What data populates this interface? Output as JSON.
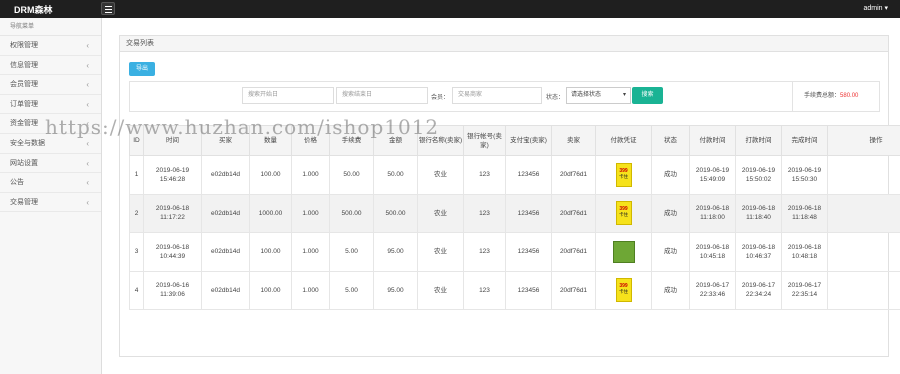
{
  "app": {
    "brand": "DRM森林",
    "user": "admin ▾"
  },
  "sidebar": {
    "heading": "导航菜单",
    "items": [
      {
        "label": "权限管理"
      },
      {
        "label": "信息管理"
      },
      {
        "label": "会员管理"
      },
      {
        "label": "订单管理"
      },
      {
        "label": "资金管理"
      },
      {
        "label": "安全与数据"
      },
      {
        "label": "网站设置"
      },
      {
        "label": "公告"
      },
      {
        "label": "交易管理"
      }
    ]
  },
  "panel": {
    "title": "交易列表",
    "export_label": "导出"
  },
  "filters": {
    "start_placeholder": "搜索开始日",
    "end_placeholder": "搜索结束日",
    "member_label": "会员：",
    "member_placeholder": "交易商家",
    "status_label": "状态：",
    "status_value": "请选择状态",
    "search_label": "搜索",
    "total_label": "手续费总额：",
    "total_value": "580.00"
  },
  "table": {
    "headers": [
      "ID",
      "时间",
      "买家",
      "数量",
      "价格",
      "手续费",
      "金额",
      "银行名称(卖家)",
      "银行帐号(卖家)",
      "支付宝(卖家)",
      "卖家",
      "付款凭证",
      "状态",
      "付款时间",
      "打款时间",
      "完成时间",
      "操作"
    ],
    "rows": [
      {
        "id": "1",
        "time": "2019-06-19 15:46:28",
        "buyer": "e02db14d",
        "qty": "100.00",
        "price": "1.000",
        "fee": "50.00",
        "amount": "50.00",
        "bank": "农业",
        "account": "123",
        "alipay": "123456",
        "seller": "20df76d1",
        "proof": "yellow",
        "status": "成功",
        "paid": "2019-06-19 15:49:09",
        "transfer": "2019-06-19 15:50:02",
        "done": "2019-06-19 15:50:30",
        "op": ""
      },
      {
        "id": "2",
        "time": "2019-06-18 11:17:22",
        "buyer": "e02db14d",
        "qty": "1000.00",
        "price": "1.000",
        "fee": "500.00",
        "amount": "500.00",
        "bank": "农业",
        "account": "123",
        "alipay": "123456",
        "seller": "20df76d1",
        "proof": "yellow",
        "status": "成功",
        "paid": "2019-06-18 11:18:00",
        "transfer": "2019-06-18 11:18:40",
        "done": "2019-06-18 11:18:48",
        "op": ""
      },
      {
        "id": "3",
        "time": "2019-06-18 10:44:39",
        "buyer": "e02db14d",
        "qty": "100.00",
        "price": "1.000",
        "fee": "5.00",
        "amount": "95.00",
        "bank": "农业",
        "account": "123",
        "alipay": "123456",
        "seller": "20df76d1",
        "proof": "green",
        "status": "成功",
        "paid": "2019-06-18 10:45:18",
        "transfer": "2019-06-18 10:46:37",
        "done": "2019-06-18 10:48:18",
        "op": ""
      },
      {
        "id": "4",
        "time": "2019-06-16 11:39:06",
        "buyer": "e02db14d",
        "qty": "100.00",
        "price": "1.000",
        "fee": "5.00",
        "amount": "95.00",
        "bank": "农业",
        "account": "123",
        "alipay": "123456",
        "seller": "20df76d1",
        "proof": "yellow",
        "status": "成功",
        "paid": "2019-06-17 22:33:46",
        "transfer": "2019-06-17 22:34:24",
        "done": "2019-06-17 22:35:14",
        "op": ""
      }
    ],
    "proof_caption_top": "399",
    "proof_caption_bottom": "卡住"
  },
  "watermark": "https://www.huzhan.com/ishop1012",
  "colors": {
    "topbar": "#1f1f1f",
    "export": "#3ab0e2",
    "search": "#1ab394",
    "total": "#ee3333"
  }
}
